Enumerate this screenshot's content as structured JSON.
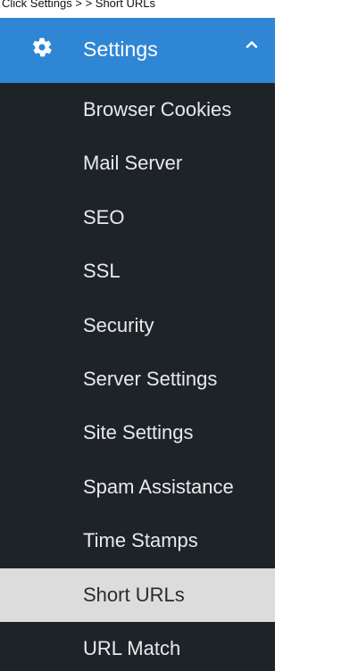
{
  "caption": "Click Settings > > Short URLs",
  "menu": {
    "header": {
      "label": "Settings",
      "icon": "gear-icon",
      "chevron": "chevron-up-icon",
      "color": "#2f86d5"
    },
    "items": [
      {
        "label": "Browser Cookies"
      },
      {
        "label": "Mail Server"
      },
      {
        "label": "SEO"
      },
      {
        "label": "SSL"
      },
      {
        "label": "Security"
      },
      {
        "label": "Server Settings"
      },
      {
        "label": "Site Settings"
      },
      {
        "label": "Spam Assistance"
      },
      {
        "label": "Time Stamps"
      },
      {
        "label": "Short URLs",
        "active": true
      },
      {
        "label": "URL Match"
      }
    ],
    "background": "#1e2328",
    "active_background": "#dcdcdc"
  }
}
